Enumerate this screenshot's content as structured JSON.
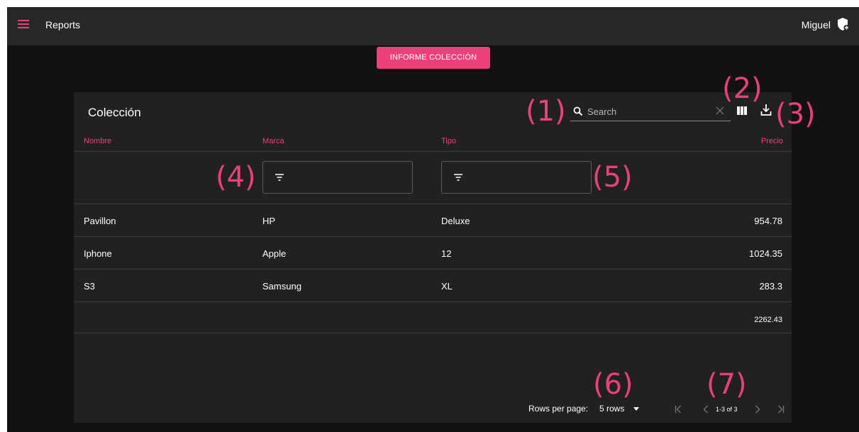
{
  "appbar": {
    "title": "Reports",
    "user_name": "Miguel",
    "menu_icon": "hamburger-menu-icon",
    "user_icon": "admin-shield-icon"
  },
  "report_button": {
    "label": "INFORME COLECCIÓN"
  },
  "table": {
    "title": "Colección",
    "search": {
      "placeholder": "Search",
      "value": ""
    },
    "toolbar_icons": [
      "search-icon",
      "clear-icon",
      "view-columns-icon",
      "download-icon"
    ],
    "columns": [
      "Nombre",
      "Marca",
      "Tipo",
      "Precio"
    ],
    "rows": [
      [
        "Pavillon",
        "HP",
        "Deluxe",
        "954.78"
      ],
      [
        "Iphone",
        "Apple",
        "12",
        "1024.35"
      ],
      [
        "S3",
        "Samsung",
        "XL",
        "283.3"
      ]
    ],
    "total": "2262.43",
    "pagination": {
      "rows_per_page_label": "Rows per page:",
      "rows_per_page_value": "5 rows",
      "page_info": "1-3 of 3"
    }
  },
  "annotations": [
    "(1)",
    "(2)",
    "(3)",
    "(4)",
    "(5)",
    "(6)",
    "(7)"
  ],
  "colors": {
    "accent": "#ec407a",
    "appbar": "#272727",
    "background": "#121212",
    "card": "#212121"
  }
}
